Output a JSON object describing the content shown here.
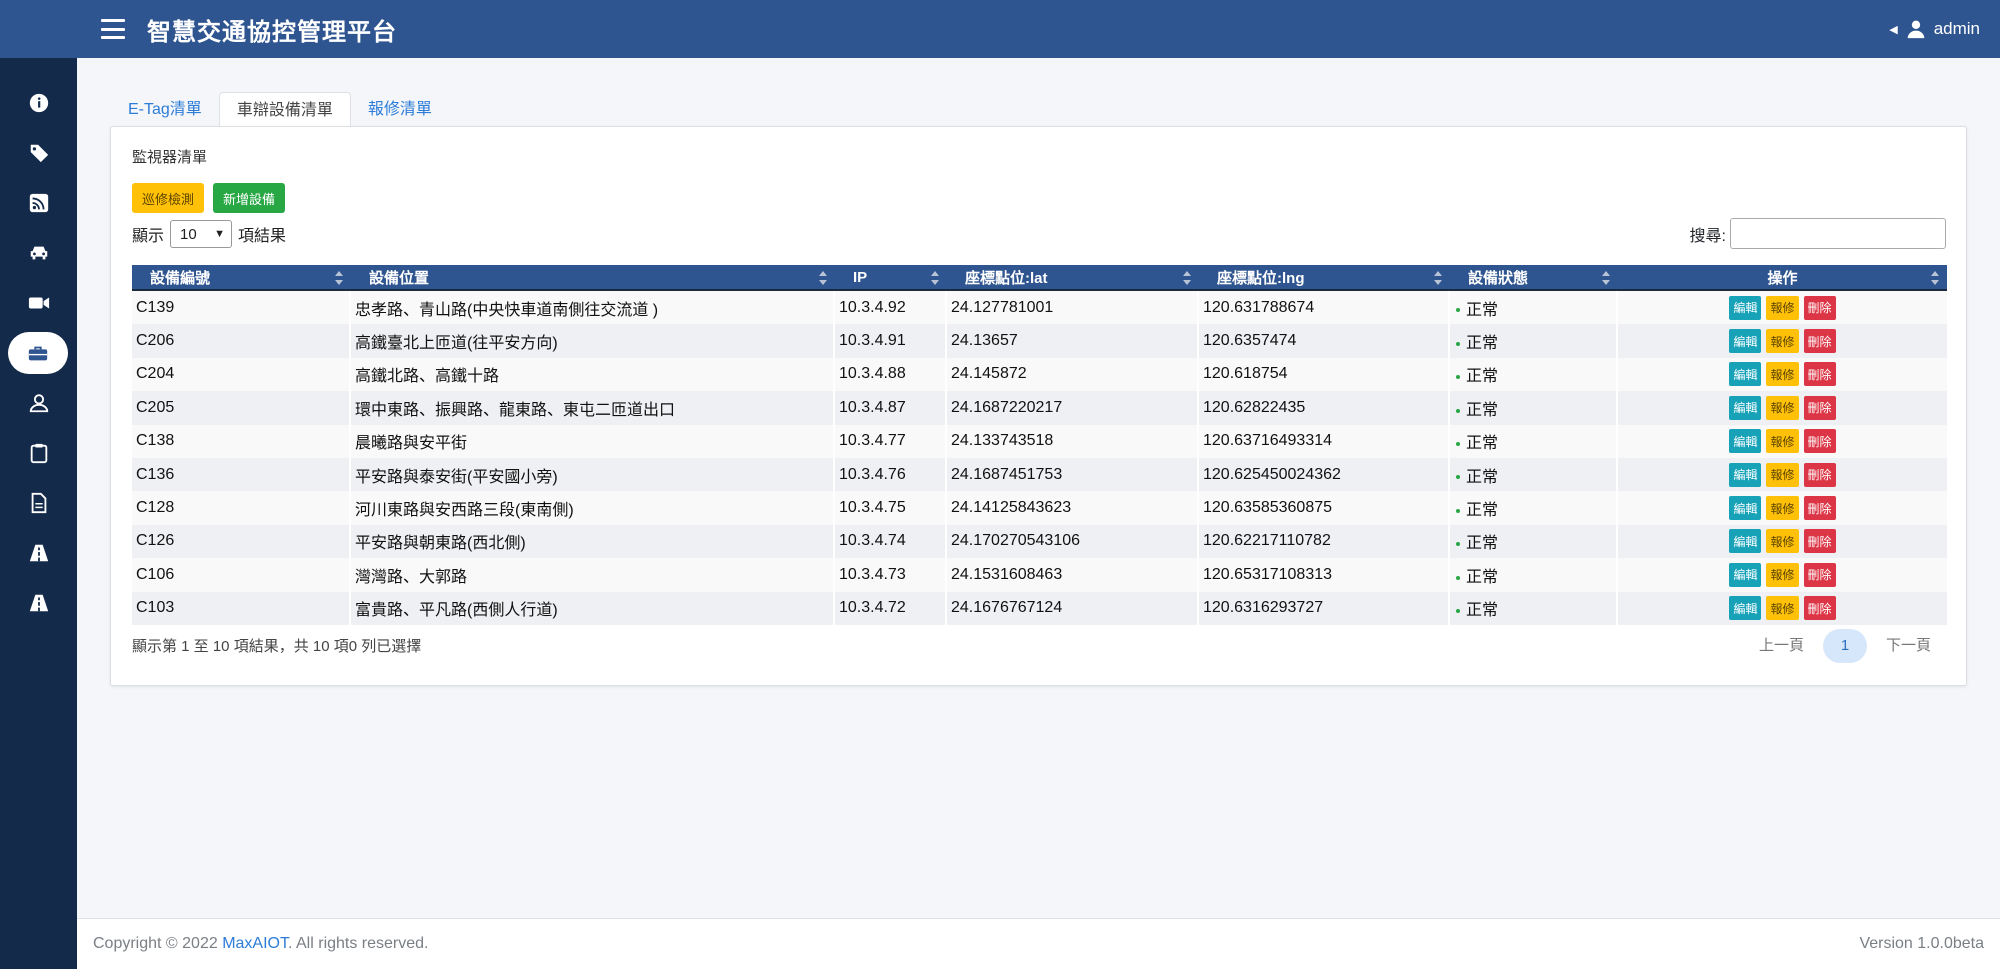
{
  "header": {
    "title": "智慧交通協控管理平台",
    "user": "admin"
  },
  "sidebar": {
    "items": [
      {
        "icon": "info-circle-icon"
      },
      {
        "icon": "tag-icon"
      },
      {
        "icon": "rss-icon"
      },
      {
        "icon": "car-icon"
      },
      {
        "icon": "video-camera-icon"
      },
      {
        "icon": "toolbox-icon",
        "active": true
      },
      {
        "icon": "user-icon"
      },
      {
        "icon": "clipboard-icon"
      },
      {
        "icon": "file-icon"
      },
      {
        "icon": "road-icon"
      },
      {
        "icon": "road-icon"
      }
    ]
  },
  "tabs": [
    {
      "label": "E-Tag清單"
    },
    {
      "label": "車辯設備清單",
      "active": true
    },
    {
      "label": "報修清單"
    }
  ],
  "card": {
    "title": "監視器清單",
    "btn_inspect": "巡修檢測",
    "btn_add": "新增設備",
    "length_prefix": "顯示",
    "length_value": "10",
    "length_suffix": "項結果",
    "search_label": "搜尋:",
    "search_value": ""
  },
  "table": {
    "headers": [
      "設備編號",
      "設備位置",
      "IP",
      "座標點位:lat",
      "座標點位:lng",
      "設備狀態",
      "操作"
    ],
    "action_labels": {
      "edit": "編輯",
      "repair": "報修",
      "delete": "刪除"
    },
    "rows": [
      {
        "id": "C139",
        "location": "忠孝路、青山路(中央快車道南側往交流道 )",
        "ip": "10.3.4.92",
        "lat": "24.127781001",
        "lng": "120.631788674",
        "status": "正常"
      },
      {
        "id": "C206",
        "location": "高鐵臺北上匝道(往平安方向)",
        "ip": "10.3.4.91",
        "lat": "24.13657",
        "lng": "120.6357474",
        "status": "正常"
      },
      {
        "id": "C204",
        "location": "高鐵北路、高鐵十路",
        "ip": "10.3.4.88",
        "lat": "24.145872",
        "lng": "120.618754",
        "status": "正常"
      },
      {
        "id": "C205",
        "location": "環中東路、振興路、龍東路、東屯二匝道出口",
        "ip": "10.3.4.87",
        "lat": "24.1687220217",
        "lng": "120.62822435",
        "status": "正常"
      },
      {
        "id": "C138",
        "location": "晨曦路與安平街",
        "ip": "10.3.4.77",
        "lat": "24.133743518",
        "lng": "120.63716493314",
        "status": "正常"
      },
      {
        "id": "C136",
        "location": "平安路與泰安街(平安國小旁)",
        "ip": "10.3.4.76",
        "lat": "24.1687451753",
        "lng": "120.625450024362",
        "status": "正常"
      },
      {
        "id": "C128",
        "location": "河川東路與安西路三段(東南側)",
        "ip": "10.3.4.75",
        "lat": "24.14125843623",
        "lng": "120.63585360875",
        "status": "正常"
      },
      {
        "id": "C126",
        "location": "平安路與朝東路(西北側)",
        "ip": "10.3.4.74",
        "lat": "24.170270543106",
        "lng": "120.62217110782",
        "status": "正常"
      },
      {
        "id": "C106",
        "location": "灣灣路、大郭路",
        "ip": "10.3.4.73",
        "lat": "24.1531608463",
        "lng": "120.65317108313",
        "status": "正常"
      },
      {
        "id": "C103",
        "location": "富貴路、平凡路(西側人行道)",
        "ip": "10.3.4.72",
        "lat": "24.1676767124",
        "lng": "120.6316293727",
        "status": "正常"
      }
    ],
    "info": "顯示第 1 至 10 項結果，共 10 項0 列已選擇"
  },
  "pager": {
    "prev": "上一頁",
    "current": "1",
    "next": "下一頁"
  },
  "footer": {
    "copyright_prefix": "Copyright © 2022 ",
    "brand": "MaxAIOT",
    "copyright_suffix": ". All rights reserved.",
    "version": "Version 1.0.0beta"
  },
  "colors": {
    "primary": "#2f5590",
    "sidebar": "#142a4a",
    "status_ok": "#28a745"
  }
}
